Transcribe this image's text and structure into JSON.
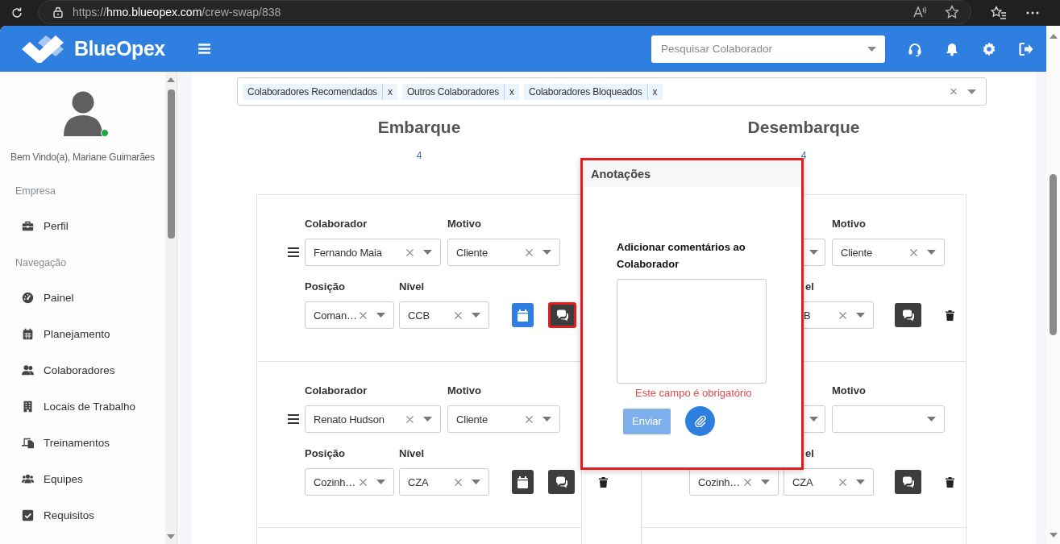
{
  "browser": {
    "url": "https://**hmo.blueopex.com**/crew-swap/838"
  },
  "header": {
    "brand": "BlueOpex",
    "search": {
      "placeholder": "Pesquisar Colaborador"
    }
  },
  "sidebar": {
    "greeting": "Bem Vindo(a), Mariane Guimarães",
    "online": true,
    "sections": [
      {
        "title": "Empresa",
        "items": [
          {
            "label": "Perfil"
          }
        ]
      },
      {
        "title": "Navegação",
        "items": [
          {
            "label": "Painel"
          },
          {
            "label": "Planejamento"
          },
          {
            "label": "Colaboradores"
          },
          {
            "label": "Locais de Trabalho"
          },
          {
            "label": "Treinamentos"
          },
          {
            "label": "Equipes"
          },
          {
            "label": "Requisitos"
          }
        ]
      }
    ]
  },
  "filter": {
    "tags": [
      {
        "label": "Colaboradores Recomendados",
        "remove": "x"
      },
      {
        "label": "Outros Colaboradores",
        "remove": "x"
      },
      {
        "label": "Colaboradores Bloqueados",
        "remove": "x"
      }
    ],
    "clear": "×"
  },
  "columns": [
    {
      "title": "Embarque",
      "count": "4",
      "rows": [
        {
          "drag": true,
          "colaborador": {
            "label": "Colaborador",
            "value": "Fernando Maia"
          },
          "motivo": {
            "label": "Motivo",
            "value": "Cliente"
          },
          "posicao": {
            "label": "Posição",
            "value": "Coman…"
          },
          "nivel": {
            "label": "Nível",
            "value": "CCB"
          },
          "calendar": {
            "active": true
          },
          "notes": {
            "highlighted": true
          }
        },
        {
          "drag": true,
          "colaborador": {
            "label": "Colaborador",
            "value": "Renato Hudson"
          },
          "motivo": {
            "label": "Motivo",
            "value": "Cliente"
          },
          "posicao": {
            "label": "Posição",
            "value": "Cozinh…"
          },
          "nivel": {
            "label": "Nível",
            "value": "CZA"
          },
          "calendar": {
            "active": false
          },
          "notes": {
            "highlighted": false
          },
          "delete": true
        }
      ]
    },
    {
      "title": "Desembarque",
      "count": "4",
      "rows": [
        {
          "colaborador": {
            "cut": true
          },
          "motivo": {
            "label": "Motivo",
            "value": "Cliente"
          },
          "nivel": {
            "label": "el",
            "label_cut": true,
            "value": "B",
            "value_cut": true
          },
          "notes": {
            "highlighted": false
          },
          "delete": true
        },
        {
          "colaborador": {
            "cut": true
          },
          "motivo": {
            "label": "Motivo"
          },
          "posicao": {
            "value": "Cozinh…"
          },
          "nivel": {
            "label": "el",
            "label_cut": true,
            "value": "CZA"
          },
          "notes": {
            "highlighted": false
          },
          "delete": true
        }
      ]
    }
  ],
  "popover": {
    "title": "Anotações",
    "label": "Adicionar comentários ao Colaborador",
    "error": "Este campo é obrigatório",
    "submit": {
      "label": "Enviar",
      "disabled": true
    },
    "highlighted": true
  }
}
